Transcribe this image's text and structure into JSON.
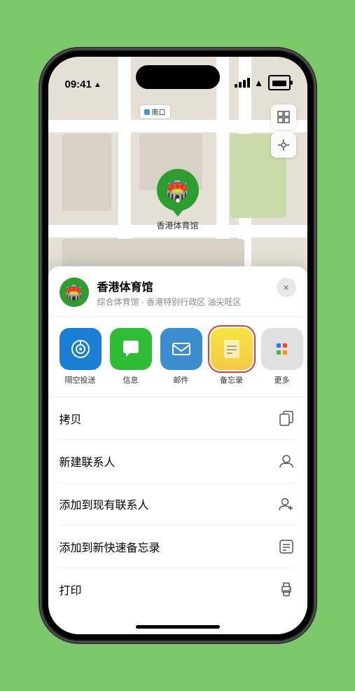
{
  "status": {
    "time": "09:41",
    "location_arrow": "▶"
  },
  "map": {
    "label_badge": "南口",
    "controls": {
      "map_type": "⊞",
      "location": "◎"
    }
  },
  "venue": {
    "name": "香港体育馆",
    "subtitle": "综合体育馆 · 香港特别行政区 油尖旺区"
  },
  "share_apps": [
    {
      "id": "airdrop",
      "label": "隔空投送",
      "emoji": "📡"
    },
    {
      "id": "messages",
      "label": "信息",
      "emoji": "💬"
    },
    {
      "id": "mail",
      "label": "邮件",
      "emoji": "✉️"
    },
    {
      "id": "notes",
      "label": "备忘录",
      "emoji": "📋"
    }
  ],
  "actions": [
    {
      "id": "copy",
      "label": "拷贝",
      "icon": "copy"
    },
    {
      "id": "new-contact",
      "label": "新建联系人",
      "icon": "person"
    },
    {
      "id": "add-existing",
      "label": "添加到现有联系人",
      "icon": "person-add"
    },
    {
      "id": "quick-note",
      "label": "添加到新快速备忘录",
      "icon": "note"
    },
    {
      "id": "print",
      "label": "打印",
      "icon": "printer"
    }
  ],
  "close_button": "×"
}
